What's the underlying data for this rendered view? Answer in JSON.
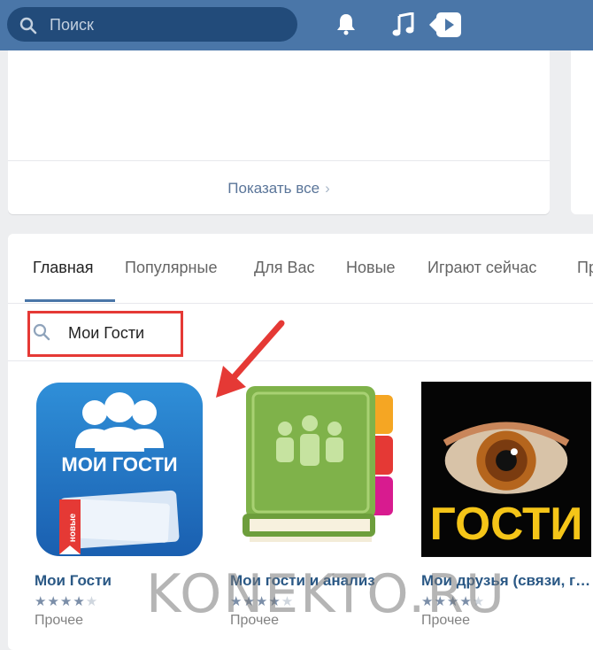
{
  "topbar": {
    "search_placeholder": "Поиск",
    "icons": [
      "search-icon",
      "bell-icon",
      "music-icon",
      "video-icon"
    ]
  },
  "upper_card": {
    "show_all": "Показать все"
  },
  "tabs": [
    {
      "label": "Главная",
      "active": true
    },
    {
      "label": "Популярные",
      "active": false
    },
    {
      "label": "Для Вас",
      "active": false
    },
    {
      "label": "Новые",
      "active": false
    },
    {
      "label": "Играют сейчас",
      "active": false
    },
    {
      "label": "Пр",
      "active": false
    }
  ],
  "app_search": {
    "query": "Мои Гости"
  },
  "apps": [
    {
      "name": "Мои Гости",
      "rating": 4,
      "category": "Прочее",
      "thumb_text": "МОИ ГОСТИ",
      "badge": "новые"
    },
    {
      "name": "Мои гости и анализ",
      "rating": 4,
      "category": "Прочее"
    },
    {
      "name": "Мои друзья (связи, г…",
      "rating": 4,
      "category": "Прочее",
      "thumb_text": "ГОСТИ"
    }
  ],
  "watermark": "KONEKTO.RU",
  "colors": {
    "topbar": "#4a76a8",
    "accent": "#4a76a8",
    "highlight": "#e53935",
    "link": "#2a5885"
  }
}
